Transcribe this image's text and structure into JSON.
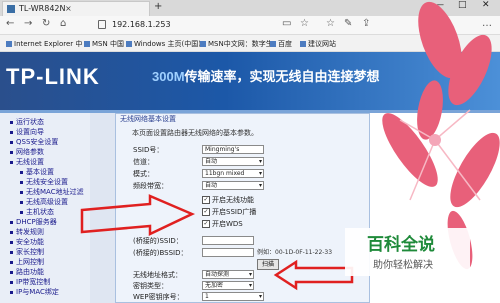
{
  "browser": {
    "tab_title": "TL-WR842N",
    "tab_close": "×",
    "new_tab": "+",
    "url": "192.168.1.253",
    "window_controls": [
      "—",
      "□",
      "✕"
    ],
    "nav_icons": [
      "back-icon",
      "forward-icon",
      "refresh-icon",
      "home-icon"
    ],
    "favorites": [
      "Internet Explorer 中",
      "MSN 中国",
      "Windows 主页(中国)",
      "MSN中文网：数字生",
      "百度",
      "建议网站"
    ]
  },
  "router": {
    "logo": "TP-LINK",
    "slogan_num": "300M",
    "slogan_text": "传输速率，实现无线自由连接梦想",
    "sidebar": [
      {
        "label": "运行状态",
        "sub": false
      },
      {
        "label": "设置向导",
        "sub": false
      },
      {
        "label": "QSS安全设置",
        "sub": false
      },
      {
        "label": "网络参数",
        "sub": false
      },
      {
        "label": "无线设置",
        "sub": false
      },
      {
        "label": "基本设置",
        "sub": true
      },
      {
        "label": "无线安全设置",
        "sub": true
      },
      {
        "label": "无线MAC地址过滤",
        "sub": true
      },
      {
        "label": "无线高级设置",
        "sub": true
      },
      {
        "label": "主机状态",
        "sub": true
      },
      {
        "label": "DHCP服务器",
        "sub": false
      },
      {
        "label": "转发规则",
        "sub": false
      },
      {
        "label": "安全功能",
        "sub": false
      },
      {
        "label": "家长控制",
        "sub": false
      },
      {
        "label": "上网控制",
        "sub": false
      },
      {
        "label": "路由功能",
        "sub": false
      },
      {
        "label": "IP带宽控制",
        "sub": false
      },
      {
        "label": "IP与MAC绑定",
        "sub": false
      }
    ],
    "panel": {
      "title": "无线网络基本设置",
      "desc": "本页面设置路由器无线网络的基本参数。",
      "ssid_label": "SSID号：",
      "ssid_value": "Mingming's",
      "channel_label": "信道：",
      "channel_value": "自动",
      "mode_label": "模式：",
      "mode_value": "11bgn mixed",
      "bandwidth_label": "频段带宽：",
      "bandwidth_value": "自动",
      "chk_wireless": "开启无线功能",
      "chk_ssid_broadcast": "开启SSID广播",
      "chk_wds": "开启WDS",
      "bridge_ssid_label": "(桥接的)SSID：",
      "bridge_bssid_label": "(桥接的)BSSID：",
      "bssid_example": "例如：00-1D-0F-11-22-33",
      "scan_button": "扫描",
      "addr_mode_label": "无线地址格式：",
      "addr_mode_value": "自动探测",
      "key_type_label": "密钥类型：",
      "key_type_value": "无加密",
      "wep_index_label": "WEP密钥序号：",
      "wep_index_value": "1"
    }
  },
  "watermark": {
    "brand": "百科全说",
    "sub": "助你轻松解决"
  },
  "colors": {
    "header": "#1c58a8",
    "arrow": "#e02020",
    "brand_green": "#1f8a3a"
  }
}
